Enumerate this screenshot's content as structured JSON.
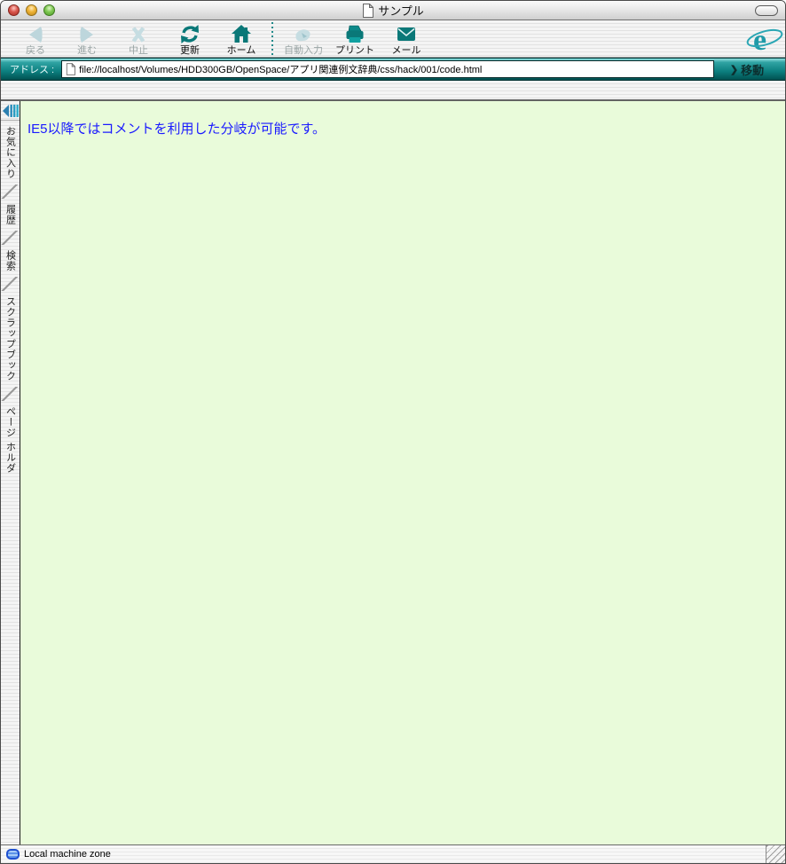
{
  "window": {
    "title": "サンプル",
    "controls": {
      "close": "close",
      "minimize": "minimize",
      "zoom": "zoom",
      "toolbar_toggle": "toolbar-toggle"
    }
  },
  "toolbar": {
    "buttons": [
      {
        "id": "back",
        "label": "戻る",
        "enabled": false
      },
      {
        "id": "forward",
        "label": "進む",
        "enabled": false
      },
      {
        "id": "stop",
        "label": "中止",
        "enabled": false
      },
      {
        "id": "refresh",
        "label": "更新",
        "enabled": true
      },
      {
        "id": "home",
        "label": "ホーム",
        "enabled": true
      },
      {
        "id": "autofill",
        "label": "自動入力",
        "enabled": false
      },
      {
        "id": "print",
        "label": "プリント",
        "enabled": true
      },
      {
        "id": "mail",
        "label": "メール",
        "enabled": true
      }
    ],
    "logo": "internet-explorer-e"
  },
  "address_bar": {
    "label": "アドレス :",
    "url": "file://localhost/Volumes/HDD300GB/OpenSpace/アプリ関連例文辞典/css/hack/001/code.html",
    "go_chevron": "❯",
    "go_label": "移動"
  },
  "sidebar": {
    "tabs": [
      {
        "id": "favorites",
        "label": "お気に入り"
      },
      {
        "id": "history",
        "label": "履歴"
      },
      {
        "id": "search",
        "label": "検索"
      },
      {
        "id": "scrapbook",
        "label": "スクラップブック"
      },
      {
        "id": "pageholder",
        "label": "ページ ホルダ"
      }
    ]
  },
  "content": {
    "text": "IE5以降ではコメントを利用した分岐が可能です。",
    "background": "#e9fbda",
    "text_color": "#1a1aff"
  },
  "status_bar": {
    "zone_text": "Local machine zone"
  },
  "colors": {
    "teal_icon": "#0a7878",
    "teal_logo": "#1f9aa8",
    "address_bar_teal": "#0c7f7f",
    "disabled_icon": "#bdd6dc",
    "disabled_label": "#9aa5a5"
  }
}
